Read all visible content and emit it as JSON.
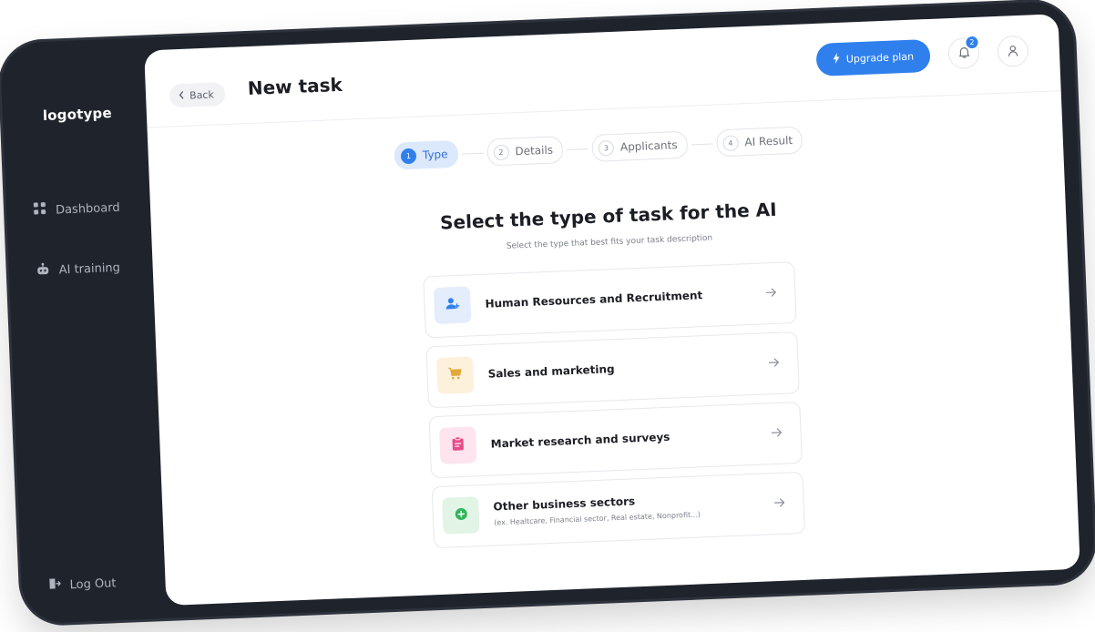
{
  "sidebar": {
    "logo": "logotype",
    "items": [
      {
        "label": "Dashboard",
        "icon": "grid-icon"
      },
      {
        "label": "AI training",
        "icon": "robot-icon"
      }
    ],
    "logout_label": "Log Out"
  },
  "header": {
    "back_label": "Back",
    "title": "New task",
    "upgrade_label": "Upgrade plan",
    "notification_count": "2"
  },
  "stepper": [
    {
      "num": "1",
      "label": "Type",
      "active": true
    },
    {
      "num": "2",
      "label": "Details",
      "active": false
    },
    {
      "num": "3",
      "label": "Applicants",
      "active": false
    },
    {
      "num": "4",
      "label": "AI Result",
      "active": false
    }
  ],
  "main": {
    "heading": "Select the type of task for the AI",
    "subheading": "Select the type that best fits your task description",
    "options": [
      {
        "label": "Human Resources and Recruitment",
        "icon": "add-user-icon",
        "icon_bg": "#e3edfc",
        "icon_color": "#2f80ed"
      },
      {
        "label": "Sales and marketing",
        "icon": "cart-icon",
        "icon_bg": "#fdf1dc",
        "icon_color": "#e2a93a"
      },
      {
        "label": "Market research and surveys",
        "icon": "clipboard-icon",
        "icon_bg": "#fde4ef",
        "icon_color": "#e84b8a"
      },
      {
        "label": "Other business sectors",
        "hint": "(ex. Healtcare, Financial sector, Real estate, Nonprofit...)",
        "icon": "plus-circle-icon",
        "icon_bg": "#e1f4e6",
        "icon_color": "#2fb55a"
      }
    ]
  },
  "colors": {
    "accent": "#2f80ed",
    "frame": "#1f232c"
  }
}
